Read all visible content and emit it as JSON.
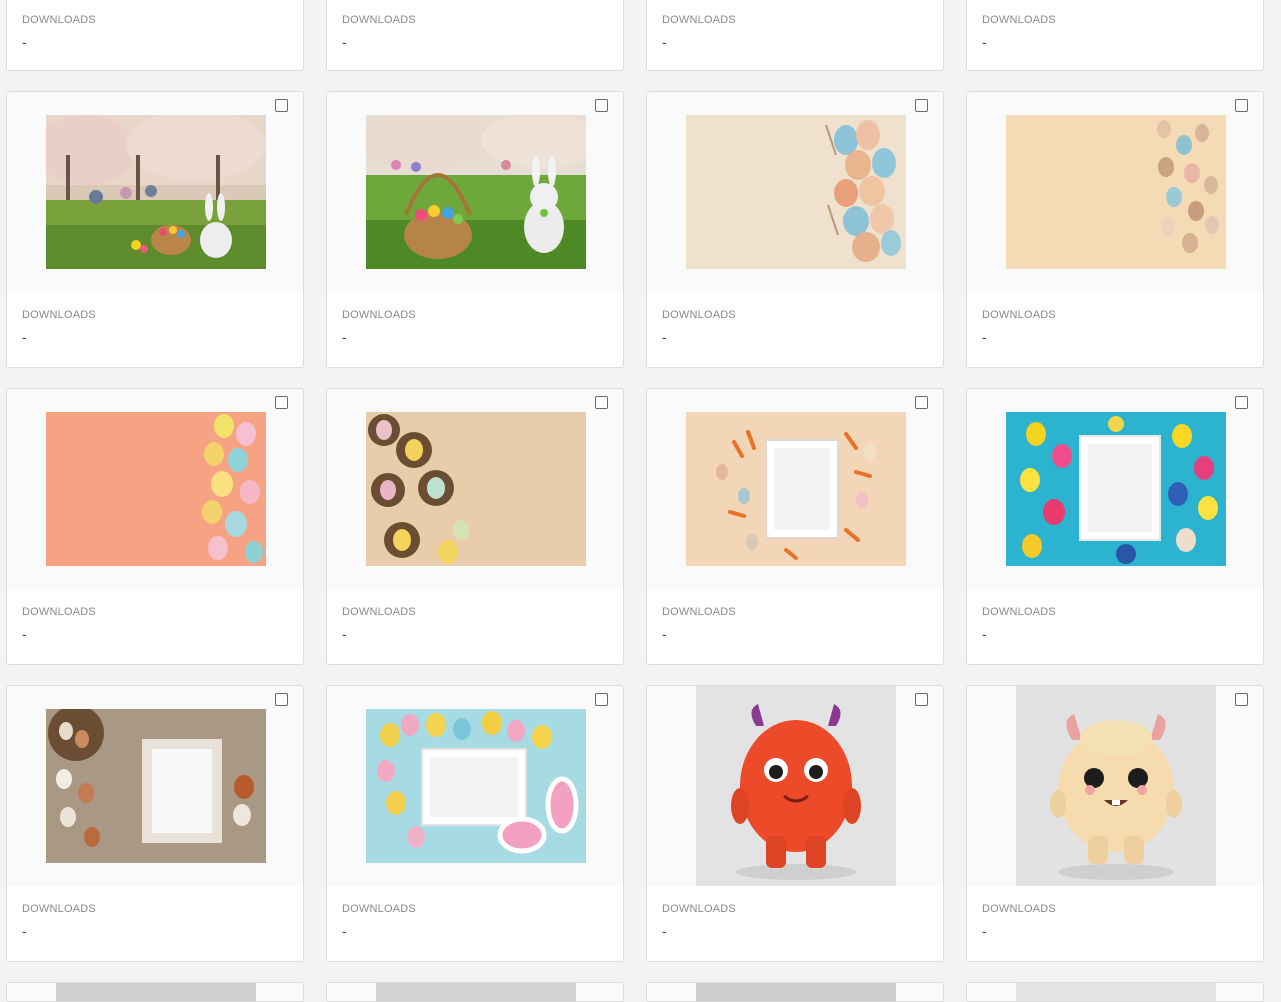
{
  "download_label": "DOWNLOADS",
  "download_value": "-",
  "top_row": [
    {
      "label": "DOWNLOADS",
      "value": "-"
    },
    {
      "label": "DOWNLOADS",
      "value": "-"
    },
    {
      "label": "DOWNLOADS",
      "value": "-"
    },
    {
      "label": "DOWNLOADS",
      "value": "-"
    }
  ],
  "rows": [
    [
      {
        "label": "DOWNLOADS",
        "value": "-",
        "image": "easter-picnic-bunny"
      },
      {
        "label": "DOWNLOADS",
        "value": "-",
        "image": "easter-basket-bunny-meadow"
      },
      {
        "label": "DOWNLOADS",
        "value": "-",
        "image": "pastel-eggs-cream-background"
      },
      {
        "label": "DOWNLOADS",
        "value": "-",
        "image": "speckled-eggs-beige-background"
      }
    ],
    [
      {
        "label": "DOWNLOADS",
        "value": "-",
        "image": "eggs-peach-background"
      },
      {
        "label": "DOWNLOADS",
        "value": "-",
        "image": "eggs-in-nests"
      },
      {
        "label": "DOWNLOADS",
        "value": "-",
        "image": "frame-carrots-eggs"
      },
      {
        "label": "DOWNLOADS",
        "value": "-",
        "image": "frame-colorful-eggs-teal"
      }
    ],
    [
      {
        "label": "DOWNLOADS",
        "value": "-",
        "image": "frame-eggs-wood"
      },
      {
        "label": "DOWNLOADS",
        "value": "-",
        "image": "frame-eggs-bunny-ears"
      },
      {
        "label": "DOWNLOADS",
        "value": "-",
        "image": "orange-horned-monster"
      },
      {
        "label": "DOWNLOADS",
        "value": "-",
        "image": "cream-horned-monster"
      }
    ]
  ],
  "colors": {
    "page_bg": "#f3f3f3",
    "card_bg": "#ffffff",
    "card_border": "#dcdcdc",
    "thumb_bg": "#fafafa",
    "label": "#8a8a8a"
  }
}
